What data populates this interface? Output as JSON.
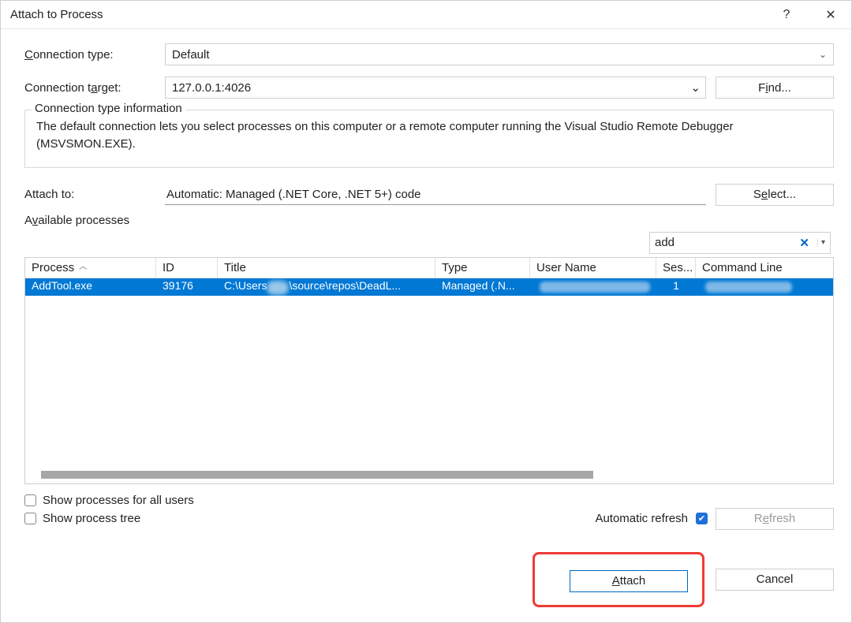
{
  "titlebar": {
    "title": "Attach to Process",
    "help": "?",
    "close": "✕"
  },
  "connection_type": {
    "label_pre": "C",
    "label_rest": "onnection type:",
    "value": "Default"
  },
  "connection_target": {
    "label_pre": "Connection t",
    "label_mid": "a",
    "label_post": "rget:",
    "value": "127.0.0.1:4026"
  },
  "find_button": {
    "pre": "F",
    "u": "i",
    "post": "nd..."
  },
  "conn_info": {
    "legend": "Connection type information",
    "text": "The default connection lets you select processes on this computer or a remote computer running the Visual Studio Remote Debugger (MSVSMON.EXE)."
  },
  "attach_to": {
    "label": "Attach to:",
    "value": "Automatic: Managed (.NET Core, .NET 5+) code"
  },
  "select_button": {
    "pre": "S",
    "u": "e",
    "post": "lect..."
  },
  "available": {
    "label_pre": "A",
    "label_u": "v",
    "label_post": "ailable processes"
  },
  "filter": {
    "value": "add"
  },
  "grid": {
    "headers": {
      "process": "Process",
      "id": "ID",
      "title": "Title",
      "type": "Type",
      "user": "User Name",
      "ses": "Ses...",
      "cmd": "Command Line"
    },
    "row": {
      "process": "AddTool.exe",
      "id": "39176",
      "title_a": "C:\\Users",
      "title_b": "\\source\\repos\\DeadL...",
      "type": "Managed (.N...",
      "ses": "1"
    }
  },
  "show_all_users": "Show processes for all users",
  "show_tree": "Show process tree",
  "auto_refresh": "Automatic refresh",
  "refresh_btn": {
    "pre": "R",
    "u": "e",
    "post": "fresh"
  },
  "attach_btn": {
    "pre": "A",
    "u": "t",
    "post": "tach"
  },
  "cancel_btn": "Cancel"
}
